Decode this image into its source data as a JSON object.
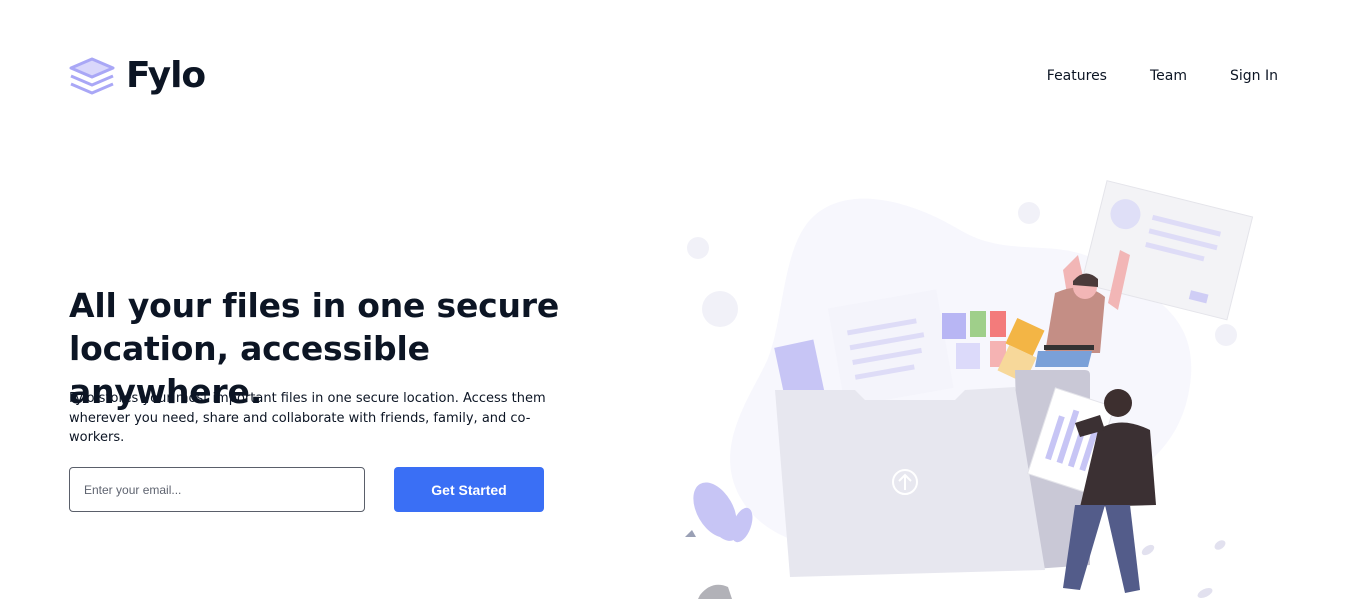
{
  "header": {
    "brand": "Fylo",
    "nav": [
      {
        "label": "Features"
      },
      {
        "label": "Team"
      },
      {
        "label": "Sign In"
      }
    ]
  },
  "hero": {
    "title": "All your files in one secure location, accessible anywhere.",
    "description": "Fylo stores your most important files in one secure location. Access them wherever you need, share and collaborate with friends, family, and co-workers.",
    "email_placeholder": "Enter your email...",
    "email_value": "",
    "cta_label": "Get Started"
  },
  "icons": {
    "logo": "stacked-layers-icon",
    "illustration_upload": "upload-arrow-icon"
  },
  "colors": {
    "text": "#0c1524",
    "primary": "#3a6ff5",
    "logo_accent": "#a9a7f6",
    "illustration_blob": "#f7f7fd"
  }
}
